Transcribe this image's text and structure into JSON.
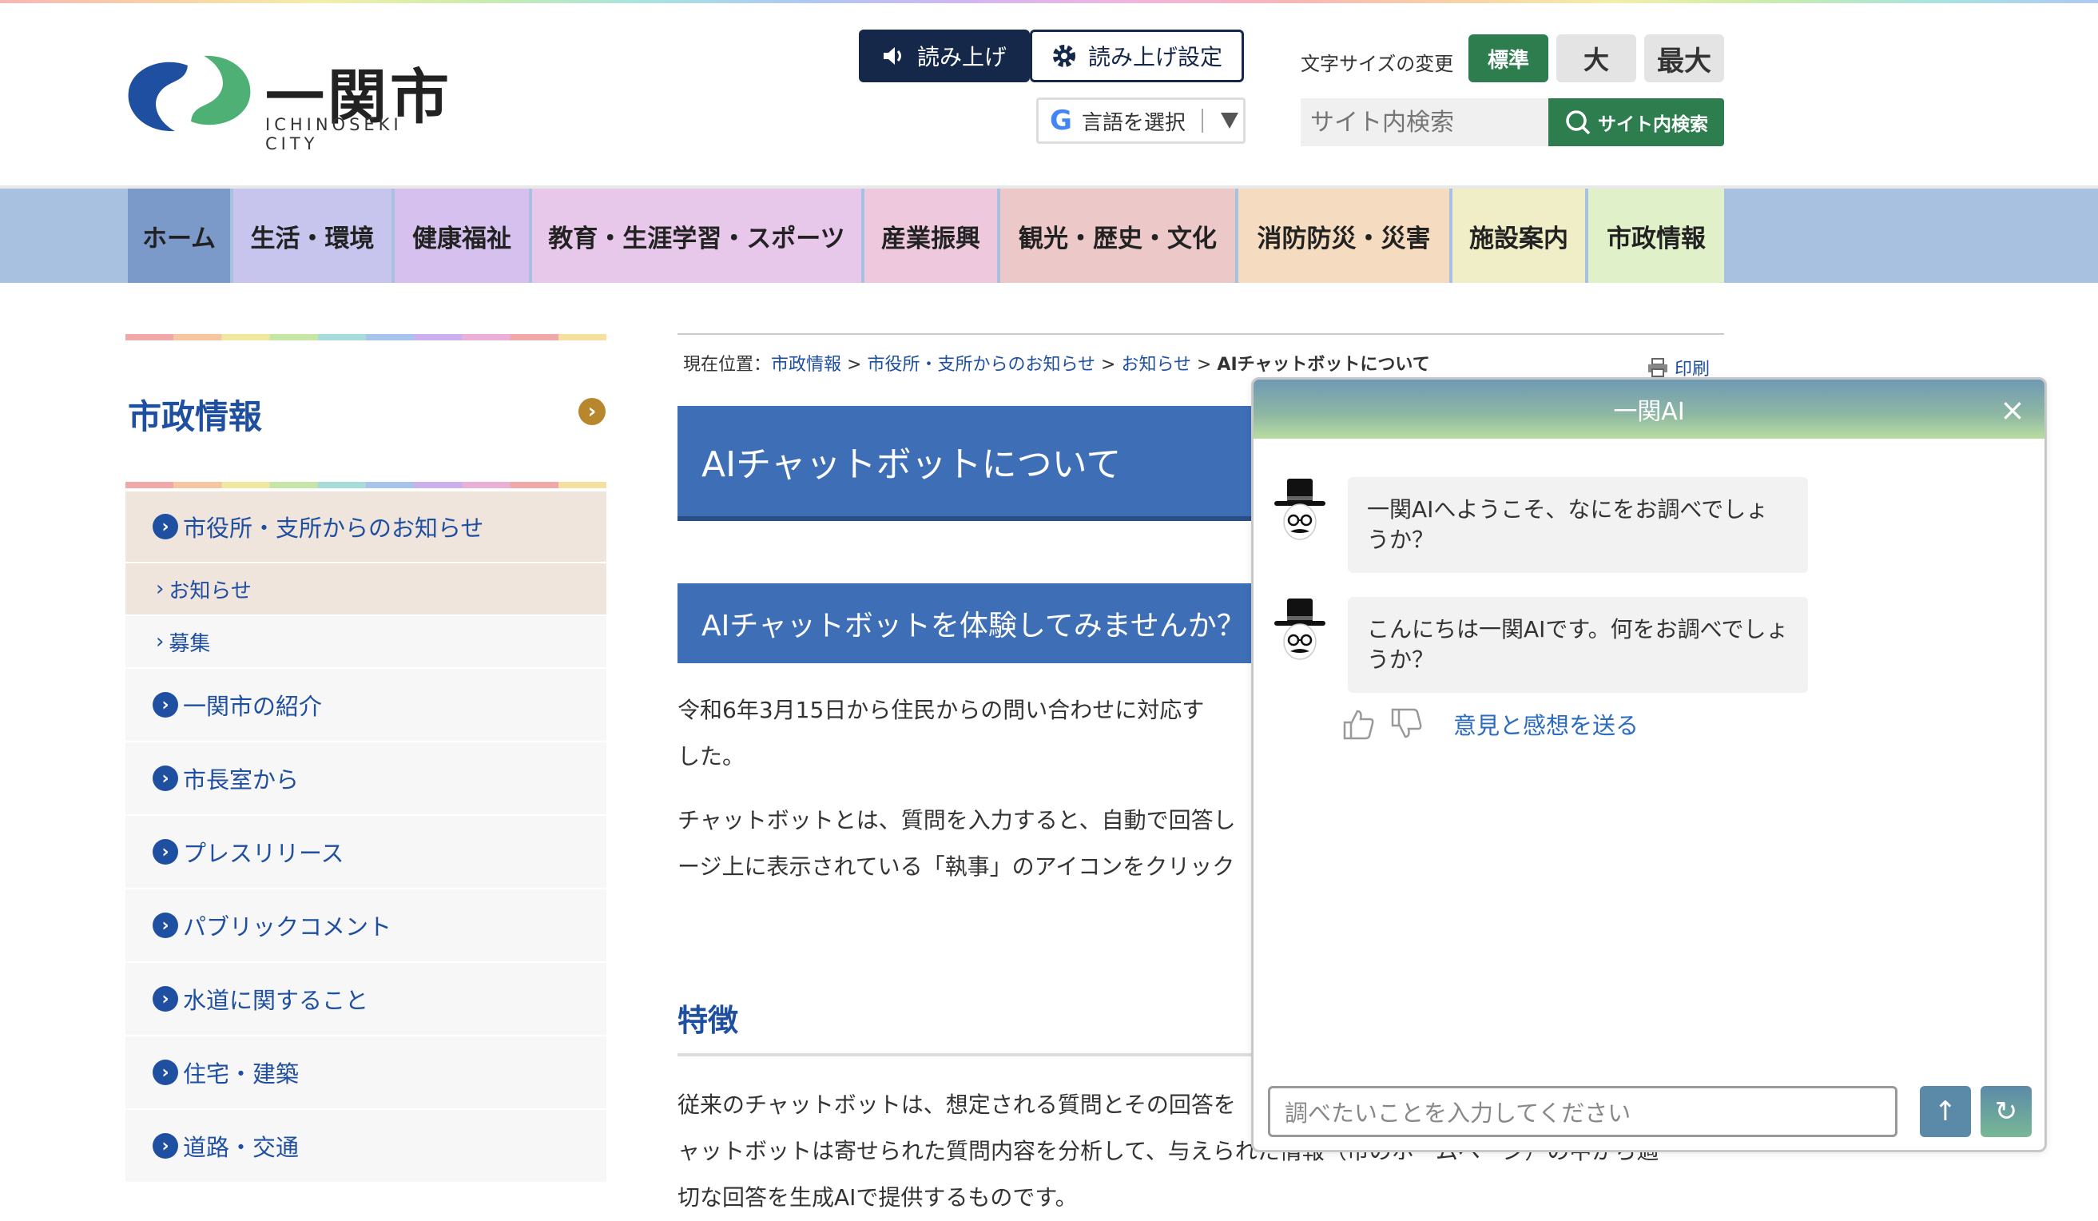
{
  "header": {
    "logo_title": "一関市",
    "logo_sub": "ICHINOSEKI CITY",
    "read_aloud": "読み上げ",
    "read_settings": "読み上げ設定",
    "language_select": "言語を選択",
    "fontsize_label": "文字サイズの変更",
    "fontsize_standard": "標準",
    "fontsize_large": "大",
    "fontsize_max": "最大",
    "search_placeholder": "サイト内検索",
    "search_button": "サイト内検索"
  },
  "nav": [
    {
      "label": "ホーム",
      "color": "#7c9ac9"
    },
    {
      "label": "生活・環境",
      "color": "#c7c4ee"
    },
    {
      "label": "健康福祉",
      "color": "#d6c1ee"
    },
    {
      "label": "教育・生涯学習・スポーツ",
      "color": "#e8c8ea"
    },
    {
      "label": "産業振興",
      "color": "#eec8dc"
    },
    {
      "label": "観光・歴史・文化",
      "color": "#ecc8c8"
    },
    {
      "label": "消防防災・災害",
      "color": "#f5dcc0"
    },
    {
      "label": "施設案内",
      "color": "#f0eec6"
    },
    {
      "label": "市政情報",
      "color": "#e0f0c8"
    }
  ],
  "sidebar": {
    "title": "市政情報",
    "items": [
      {
        "label": "市役所・支所からのお知らせ"
      },
      {
        "label": "お知らせ"
      },
      {
        "label": "募集"
      },
      {
        "label": "一関市の紹介"
      },
      {
        "label": "市長室から"
      },
      {
        "label": "プレスリリース"
      },
      {
        "label": "パブリックコメント"
      },
      {
        "label": "水道に関すること"
      },
      {
        "label": "住宅・建築"
      },
      {
        "label": "道路・交通"
      }
    ]
  },
  "main": {
    "breadcrumb_prefix": "現在位置：",
    "breadcrumb": [
      "市政情報",
      "市役所・支所からのお知らせ",
      "お知らせ"
    ],
    "breadcrumb_current": "AIチャットボットについて",
    "print": "印刷",
    "title": "AIチャットボットについて",
    "subtitle": "AIチャットボットを体験してみませんか？",
    "para1_line1": "令和6年3月15日から住民からの問い合わせに対応す",
    "para1_line2": "した。",
    "para2_line1": "チャットボットとは、質問を入力すると、自動で回答し",
    "para2_line2": "ージ上に表示されている「執事」のアイコンをクリック",
    "feature_heading": "特徴",
    "para3_line1": "従来のチャットボットは、想定される質問とその回答を",
    "para3_line2": "ャットボットは寄せられた質問内容を分析して、与えられた情報（市のホームページ）の中から適",
    "para3_line3": "切な回答を生成AIで提供するものです。"
  },
  "chat": {
    "title": "一関AI",
    "message1": "一関AIへようこそ、なにをお調べでしょうか？",
    "message2": "こんにちは一関AIです。何をお調べでしょうか？",
    "feedback_link": "意見と感想を送る",
    "input_placeholder": "調べたいことを入力してください"
  }
}
